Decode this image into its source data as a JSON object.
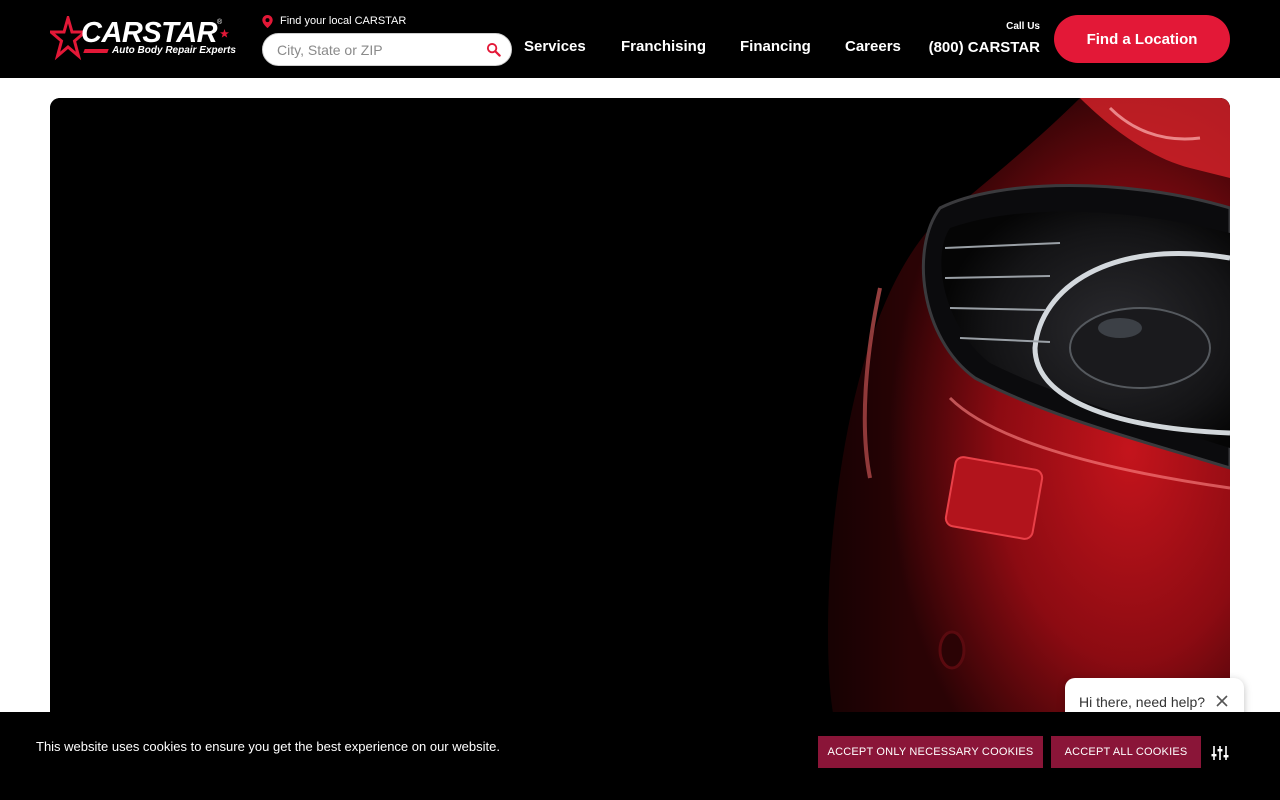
{
  "brand": {
    "name": "CARSTAR",
    "tagline": "Auto Body Repair Experts",
    "registered_mark": "®",
    "accent_color": "#e31837"
  },
  "locator": {
    "label": "Find your local CARSTAR",
    "placeholder": "City, State or ZIP",
    "value": "",
    "icon": "map-pin-icon",
    "search_icon": "search-icon"
  },
  "nav": {
    "items": [
      {
        "label": "Services"
      },
      {
        "label": "Franchising"
      },
      {
        "label": "Financing"
      },
      {
        "label": "Careers"
      }
    ]
  },
  "call": {
    "label": "Call Us",
    "number": "(800) CARSTAR"
  },
  "cta": {
    "label": "Find a Location"
  },
  "hero": {
    "image": "red-car-headlight-closeup"
  },
  "chat": {
    "text": "Hi there, need help?",
    "close_icon": "close-icon"
  },
  "cookie": {
    "text": "This website uses cookies to ensure you get the best experience on our website.",
    "necessary_label": "ACCEPT ONLY NECESSARY COOKIES",
    "all_label": "ACCEPT ALL COOKIES",
    "settings_icon": "sliders-icon",
    "button_color": "#8a1538"
  }
}
